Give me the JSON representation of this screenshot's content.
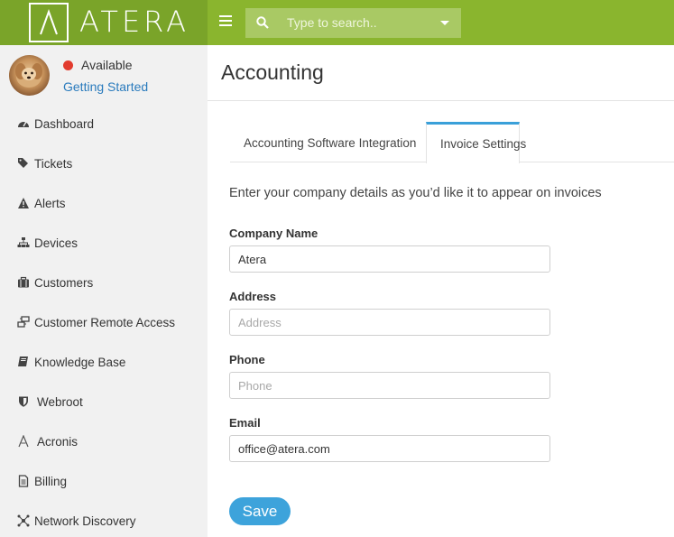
{
  "brand": {
    "name": "ATERA",
    "accent": "#8ab52e",
    "link": "#2a7bbd"
  },
  "search": {
    "placeholder": "Type to search.."
  },
  "user": {
    "status": "Available",
    "status_color": "#e23b2e",
    "getting_started": "Getting Started"
  },
  "sidebar": {
    "items": [
      {
        "label": "Dashboard",
        "icon": "dashboard-icon"
      },
      {
        "label": "Tickets",
        "icon": "tags-icon"
      },
      {
        "label": "Alerts",
        "icon": "warning-icon"
      },
      {
        "label": "Devices",
        "icon": "sitemap-icon"
      },
      {
        "label": "Customers",
        "icon": "briefcase-icon"
      },
      {
        "label": "Customer Remote Access",
        "icon": "remote-access-icon"
      },
      {
        "label": "Knowledge Base",
        "icon": "book-icon"
      },
      {
        "label": "Webroot",
        "icon": "shield-icon"
      },
      {
        "label": "Acronis",
        "icon": "acronis-icon"
      },
      {
        "label": "Billing",
        "icon": "document-icon"
      },
      {
        "label": "Network Discovery",
        "icon": "network-icon"
      }
    ]
  },
  "main": {
    "title": "Accounting",
    "tabs": [
      {
        "label": "Accounting Software Integration",
        "active": false
      },
      {
        "label": "Invoice Settings",
        "active": true
      }
    ],
    "intro": "Enter your company details as you’d like it to appear on invoices",
    "form": {
      "company_name": {
        "label": "Company Name",
        "value": "Atera",
        "placeholder": ""
      },
      "address": {
        "label": "Address",
        "value": "",
        "placeholder": "Address"
      },
      "phone": {
        "label": "Phone",
        "value": "",
        "placeholder": "Phone"
      },
      "email": {
        "label": "Email",
        "value": "office@atera.com",
        "placeholder": ""
      }
    },
    "save_label": "Save"
  }
}
